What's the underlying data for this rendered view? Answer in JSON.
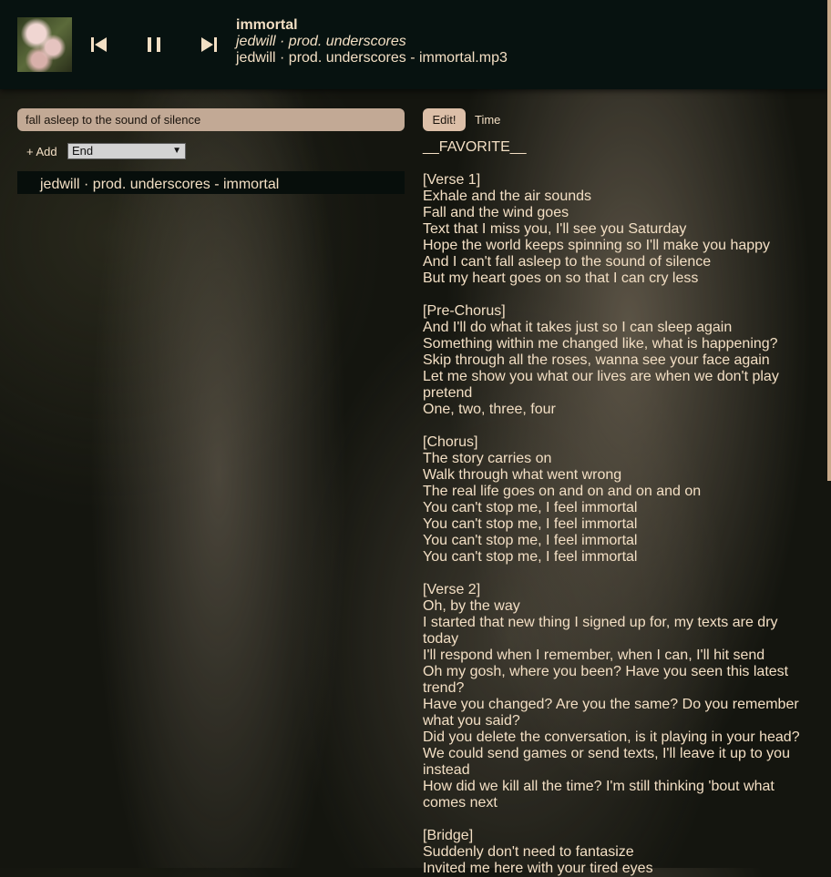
{
  "player": {
    "cover_icon": "album-cover",
    "controls": {
      "prev_icon": "skip-previous-icon",
      "pause_icon": "pause-icon",
      "next_icon": "skip-next-icon"
    },
    "now_playing": {
      "title": "immortal",
      "artist": "jedwill · prod. underscores",
      "file": "jedwill · prod. underscores - immortal.mp3"
    }
  },
  "left_panel": {
    "search_value": "fall asleep to the sound of silence",
    "add_label": "+ Add",
    "position_select": {
      "value": "End"
    },
    "playlist": [
      {
        "label": "jedwill · prod. underscores - immortal"
      }
    ]
  },
  "right_panel": {
    "tabs": [
      {
        "label": "Edit!",
        "active": true
      },
      {
        "label": "Time",
        "active": false
      }
    ],
    "lyrics": [
      "__FAVORITE__",
      "",
      "[Verse 1]",
      "Exhale and the air sounds",
      "Fall and the wind goes",
      "Text that I miss you, I'll see you Saturday",
      "Hope the world keeps spinning so I'll make you happy",
      "And I can't fall asleep to the sound of silence",
      "But my heart goes on so that I can cry less",
      "",
      "[Pre-Chorus]",
      "And I'll do what it takes just so I can sleep again",
      "Something within me changed like, what is happening?",
      "Skip through all the roses, wanna see your face again",
      "Let me show you what our lives are when we don't play pretend",
      "One, two, three, four",
      "",
      "[Chorus]",
      "The story carries on",
      "Walk through what went wrong",
      "The real life goes on and on and on and on",
      "You can't stop me, I feel immortal",
      "You can't stop me, I feel immortal",
      "You can't stop me, I feel immortal",
      "You can't stop me, I feel immortal",
      "",
      "[Verse 2]",
      "Oh, by the way",
      "I started that new thing I signed up for, my texts are dry today",
      "I'll respond when I remember, when I can, I'll hit send",
      "Oh my gosh, where you been? Have you seen this latest trend?",
      "Have you changed? Are you the same? Do you remember what you said?",
      "Did you delete the conversation, is it playing in your head?",
      "We could send games or send texts, I'll leave it up to you instead",
      "How did we kill all the time? I'm still thinking 'bout what comes next",
      "",
      "[Bridge]",
      "Suddenly don't need to fantasize",
      "Invited me here with your tired eyes"
    ]
  }
}
